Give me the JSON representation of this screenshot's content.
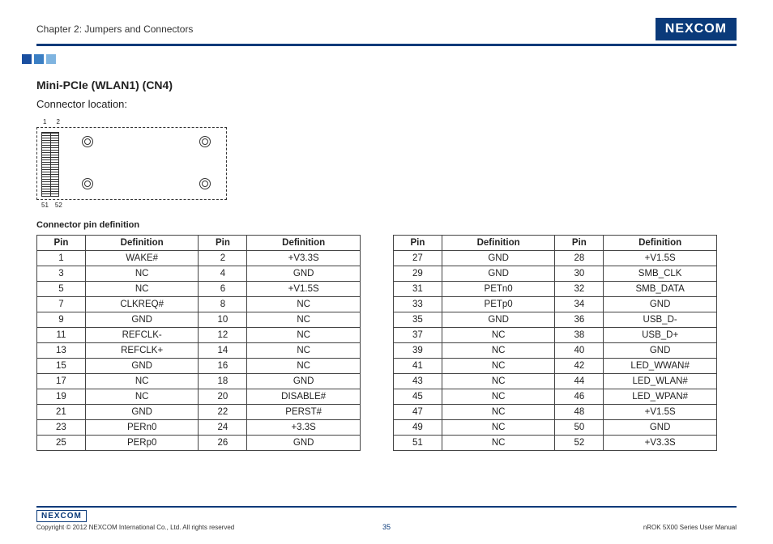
{
  "header": {
    "chapter": "Chapter 2: Jumpers and Connectors",
    "brand": "NEXCOM"
  },
  "section": {
    "title": "Mini-PCIe (WLAN1) (CN4)",
    "subtitle": "Connector location:",
    "pin_top_left": "1",
    "pin_top_right": "2",
    "pin_bot_left": "51",
    "pin_bot_right": "52",
    "table_title": "Connector pin definition"
  },
  "table_headers": {
    "pin": "Pin",
    "def": "Definition"
  },
  "pins_left": [
    {
      "p1": "1",
      "d1": "WAKE#",
      "p2": "2",
      "d2": "+V3.3S"
    },
    {
      "p1": "3",
      "d1": "NC",
      "p2": "4",
      "d2": "GND"
    },
    {
      "p1": "5",
      "d1": "NC",
      "p2": "6",
      "d2": "+V1.5S"
    },
    {
      "p1": "7",
      "d1": "CLKREQ#",
      "p2": "8",
      "d2": "NC"
    },
    {
      "p1": "9",
      "d1": "GND",
      "p2": "10",
      "d2": "NC"
    },
    {
      "p1": "11",
      "d1": "REFCLK-",
      "p2": "12",
      "d2": "NC"
    },
    {
      "p1": "13",
      "d1": "REFCLK+",
      "p2": "14",
      "d2": "NC"
    },
    {
      "p1": "15",
      "d1": "GND",
      "p2": "16",
      "d2": "NC"
    },
    {
      "p1": "17",
      "d1": "NC",
      "p2": "18",
      "d2": "GND"
    },
    {
      "p1": "19",
      "d1": "NC",
      "p2": "20",
      "d2": "DISABLE#"
    },
    {
      "p1": "21",
      "d1": "GND",
      "p2": "22",
      "d2": "PERST#"
    },
    {
      "p1": "23",
      "d1": "PERn0",
      "p2": "24",
      "d2": "+3.3S"
    },
    {
      "p1": "25",
      "d1": "PERp0",
      "p2": "26",
      "d2": "GND"
    }
  ],
  "pins_right": [
    {
      "p1": "27",
      "d1": "GND",
      "p2": "28",
      "d2": "+V1.5S"
    },
    {
      "p1": "29",
      "d1": "GND",
      "p2": "30",
      "d2": "SMB_CLK"
    },
    {
      "p1": "31",
      "d1": "PETn0",
      "p2": "32",
      "d2": "SMB_DATA"
    },
    {
      "p1": "33",
      "d1": "PETp0",
      "p2": "34",
      "d2": "GND"
    },
    {
      "p1": "35",
      "d1": "GND",
      "p2": "36",
      "d2": "USB_D-"
    },
    {
      "p1": "37",
      "d1": "NC",
      "p2": "38",
      "d2": "USB_D+"
    },
    {
      "p1": "39",
      "d1": "NC",
      "p2": "40",
      "d2": "GND"
    },
    {
      "p1": "41",
      "d1": "NC",
      "p2": "42",
      "d2": "LED_WWAN#"
    },
    {
      "p1": "43",
      "d1": "NC",
      "p2": "44",
      "d2": "LED_WLAN#"
    },
    {
      "p1": "45",
      "d1": "NC",
      "p2": "46",
      "d2": "LED_WPAN#"
    },
    {
      "p1": "47",
      "d1": "NC",
      "p2": "48",
      "d2": "+V1.5S"
    },
    {
      "p1": "49",
      "d1": "NC",
      "p2": "50",
      "d2": "GND"
    },
    {
      "p1": "51",
      "d1": "NC",
      "p2": "52",
      "d2": "+V3.3S"
    }
  ],
  "footer": {
    "brand": "NEXCOM",
    "copyright": "Copyright © 2012 NEXCOM International Co., Ltd. All rights reserved",
    "page": "35",
    "manual": "nROK 5X00 Series User Manual"
  }
}
